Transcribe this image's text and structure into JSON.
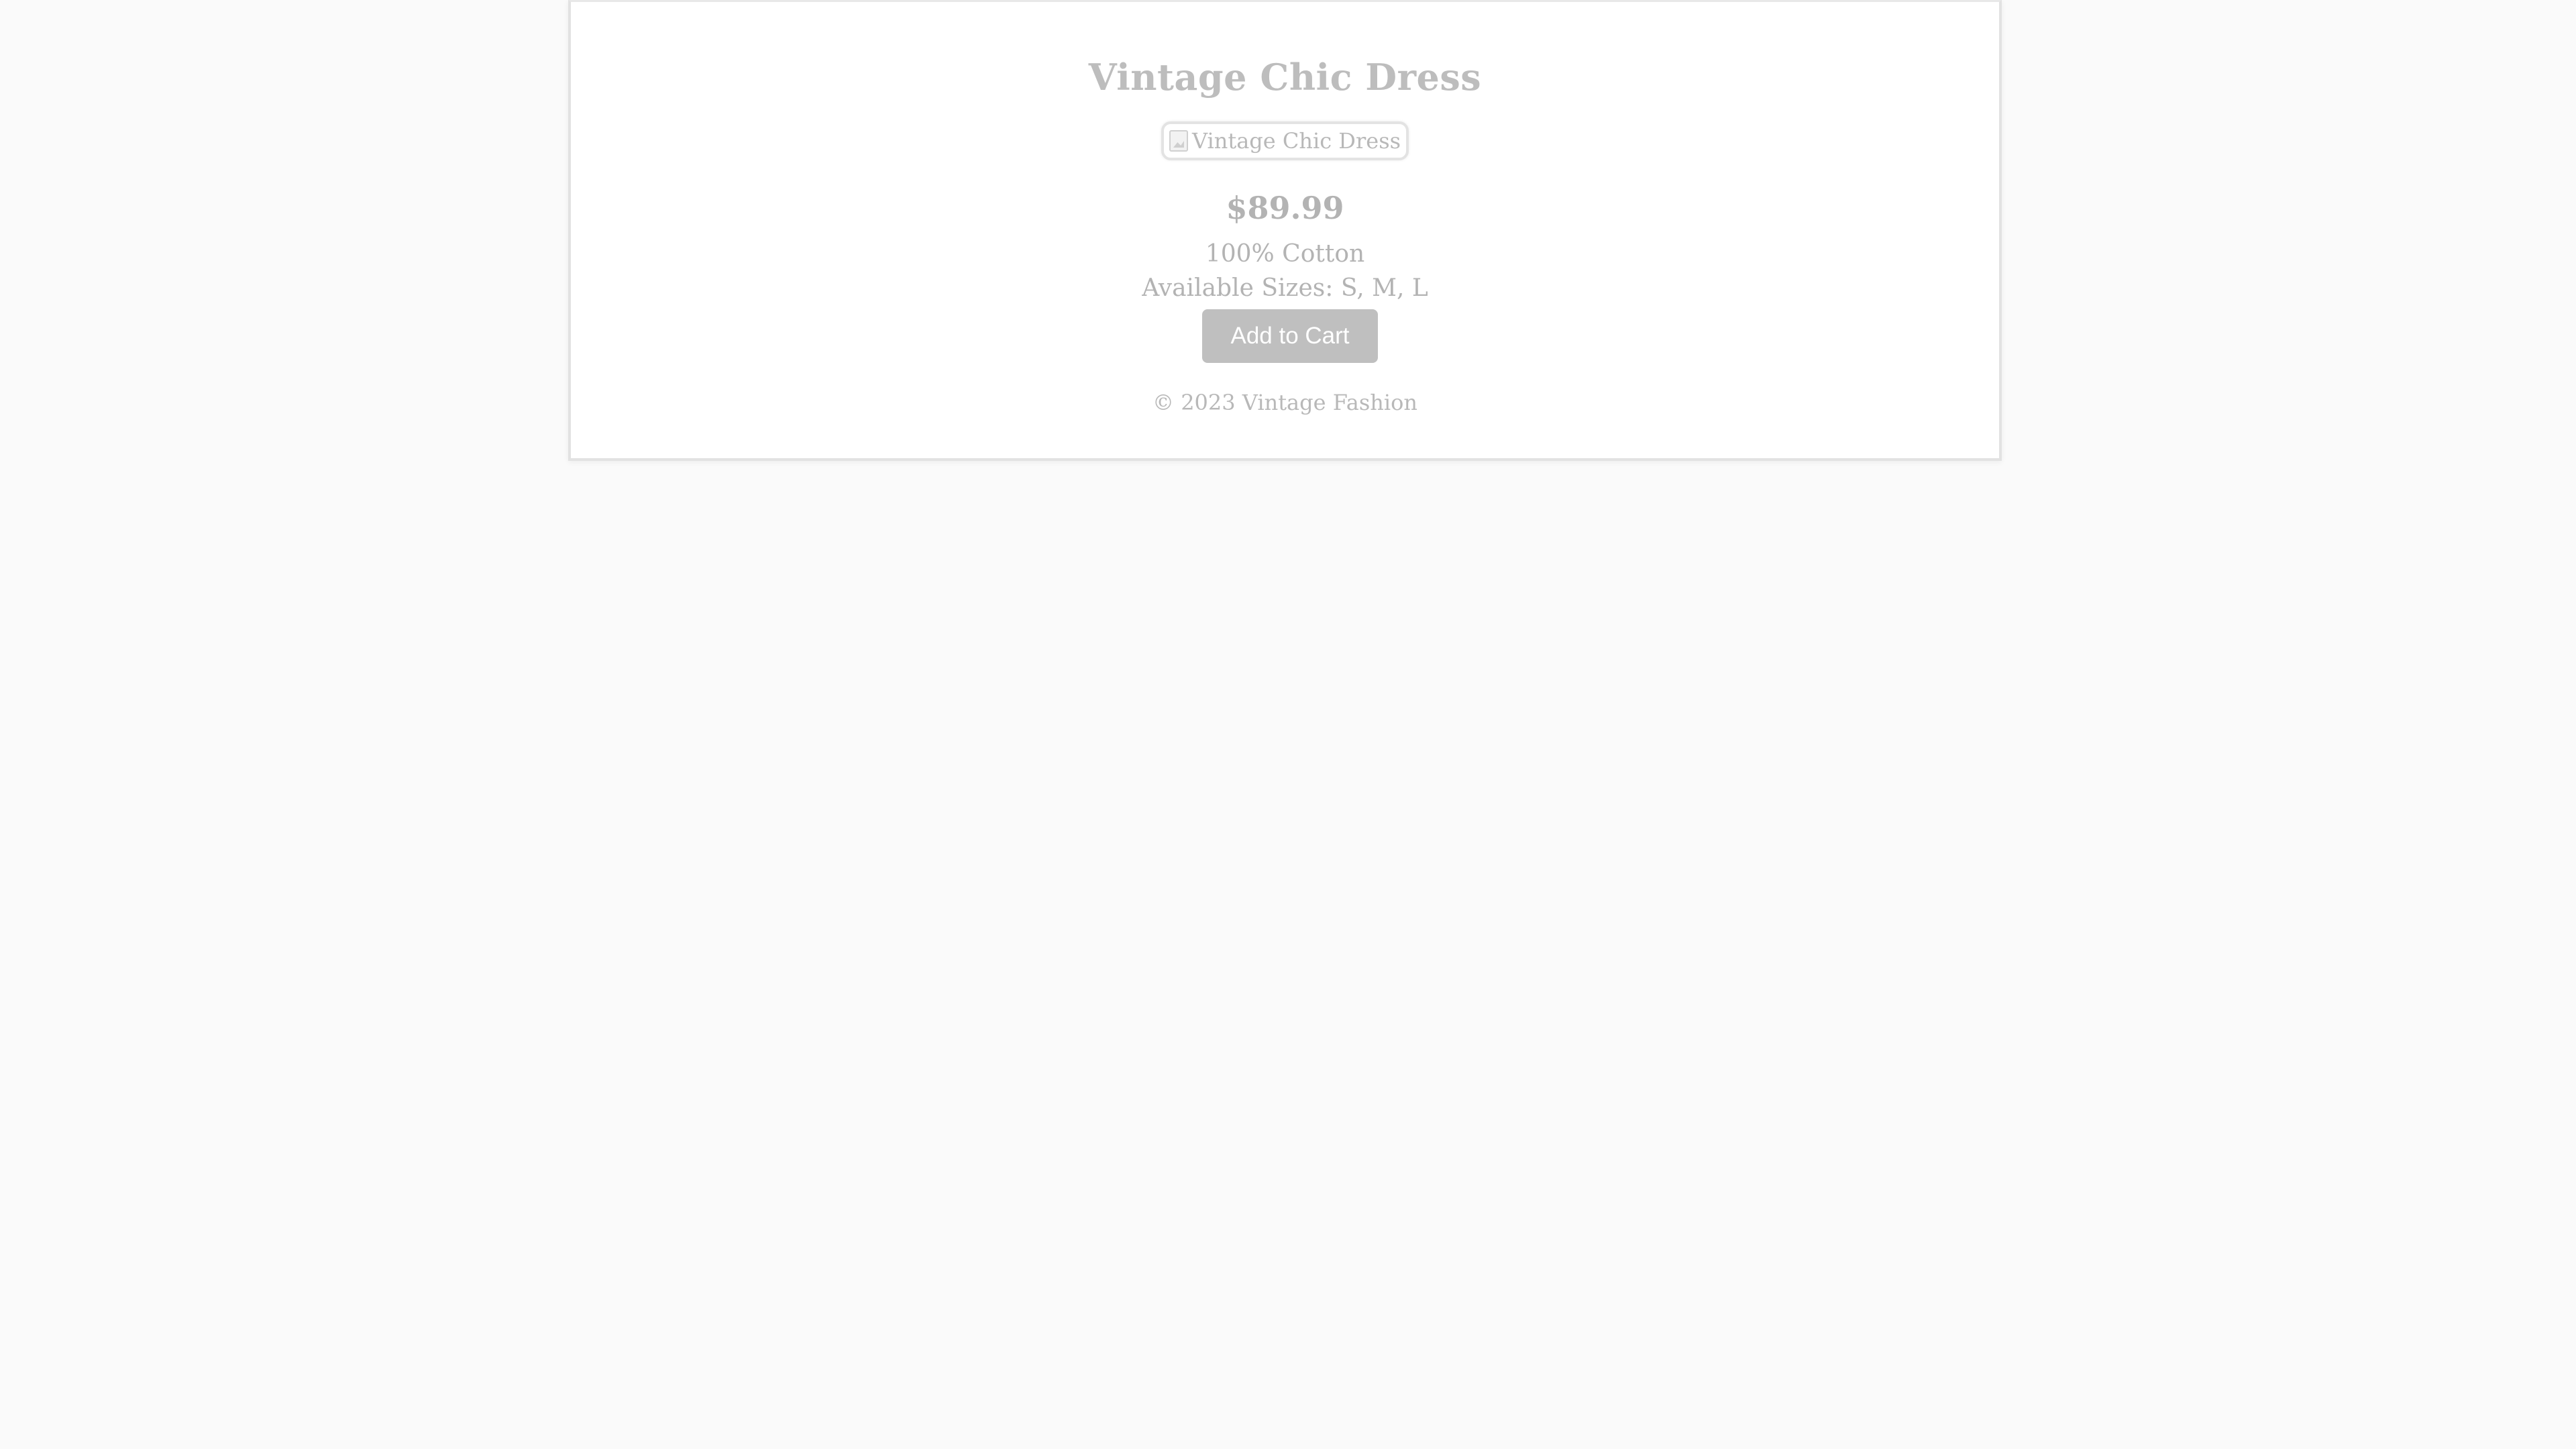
{
  "product": {
    "title": "Vintage Chic Dress",
    "image_alt": "Vintage Chic Dress",
    "price": "$89.99",
    "material": "100% Cotton",
    "sizes": "Available Sizes: S, M, L",
    "add_to_cart_label": "Add to Cart"
  },
  "footer": {
    "text": "© 2023 Vintage Fashion"
  },
  "colors": {
    "background": "#fafafa",
    "card": "#ffffff",
    "text": "#b3b3b3",
    "button": "#bfbfbf",
    "button_text": "#ffffff"
  },
  "icons": {
    "broken_image": "broken-image-icon"
  }
}
